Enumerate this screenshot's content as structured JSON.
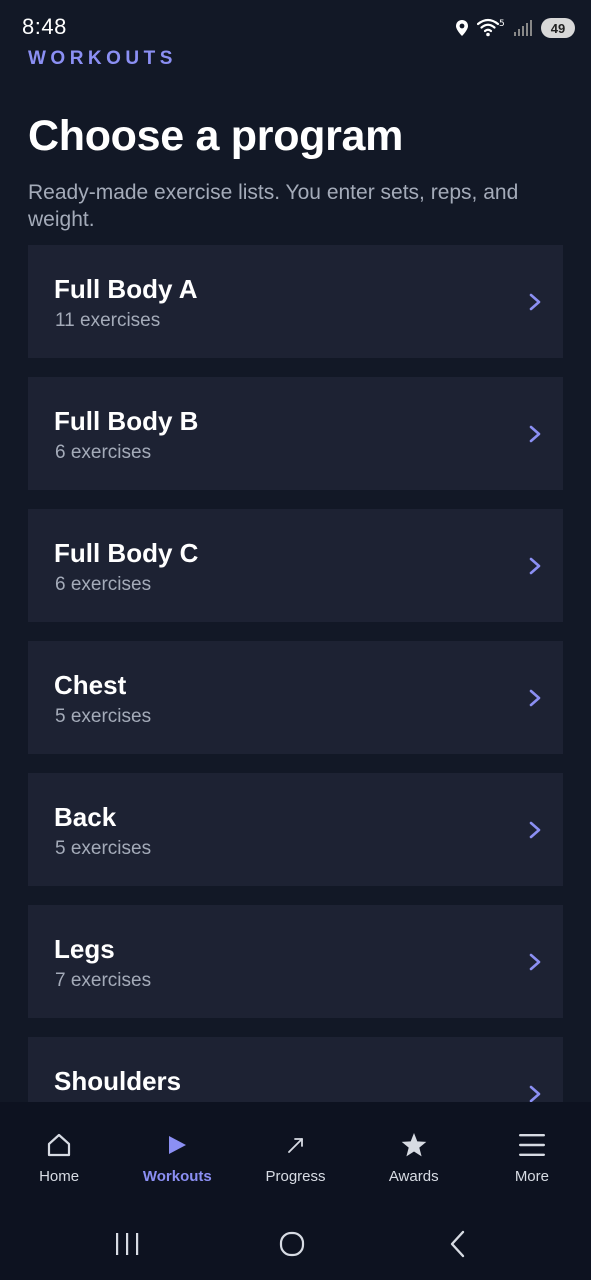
{
  "status_bar": {
    "time": "8:48",
    "battery": "49"
  },
  "header": {
    "section_label": "WORKOUTS",
    "title": "Choose a program",
    "subtitle": "Ready-made exercise lists. You enter sets, reps, and weight."
  },
  "programs": [
    {
      "name": "Full Body A",
      "count": "11 exercises"
    },
    {
      "name": "Full Body B",
      "count": "6 exercises"
    },
    {
      "name": "Full Body C",
      "count": "6 exercises"
    },
    {
      "name": "Chest",
      "count": "5 exercises"
    },
    {
      "name": "Back",
      "count": "5 exercises"
    },
    {
      "name": "Legs",
      "count": "7 exercises"
    },
    {
      "name": "Shoulders",
      "count": ""
    }
  ],
  "bottom_nav": {
    "items": [
      {
        "label": "Home",
        "icon": "home-icon"
      },
      {
        "label": "Workouts",
        "icon": "play-icon"
      },
      {
        "label": "Progress",
        "icon": "trend-arrow-icon"
      },
      {
        "label": "Awards",
        "icon": "star-icon"
      },
      {
        "label": "More",
        "icon": "menu-icon"
      }
    ],
    "active": "Workouts"
  },
  "colors": {
    "background": "#121826",
    "card": "#1d2233",
    "accent": "#8b8ff3",
    "muted_text": "#a4abb9",
    "nav_background": "#0d1220"
  },
  "system_nav": {
    "icons": [
      "recent-apps-icon",
      "home-circle-icon",
      "back-icon"
    ]
  }
}
